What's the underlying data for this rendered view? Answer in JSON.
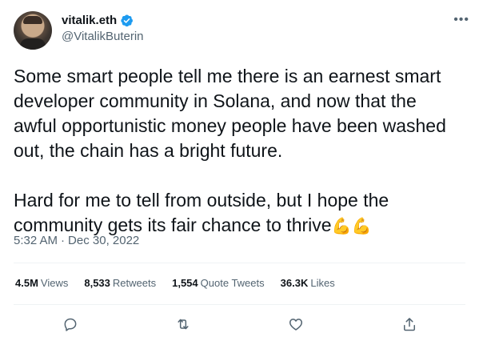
{
  "author": {
    "display_name": "vitalik.eth",
    "handle": "@VitalikButerin",
    "verified_color": "#1d9bf0"
  },
  "menu": {
    "more_label": "•••"
  },
  "tweet": {
    "text": "Some smart people tell me there is an earnest smart\ndeveloper community in Solana, and now that the\nawful opportunistic money people have been washed\nout, the chain has a bright future.\n\nHard for me to tell from outside, but I hope the\ncommunity gets its fair chance to thrive",
    "emoji": "💪💪"
  },
  "meta": {
    "time": "5:32 AM",
    "separator": "·",
    "date": "Dec 30, 2022"
  },
  "stats": [
    {
      "value": "4.5M",
      "label": "Views"
    },
    {
      "value": "8,533",
      "label": "Retweets"
    },
    {
      "value": "1,554",
      "label": "Quote Tweets"
    },
    {
      "value": "36.3K",
      "label": "Likes"
    }
  ],
  "actions": {
    "reply_icon": "reply-icon",
    "retweet_icon": "retweet-icon",
    "like_icon": "heart-icon",
    "share_icon": "share-icon"
  }
}
